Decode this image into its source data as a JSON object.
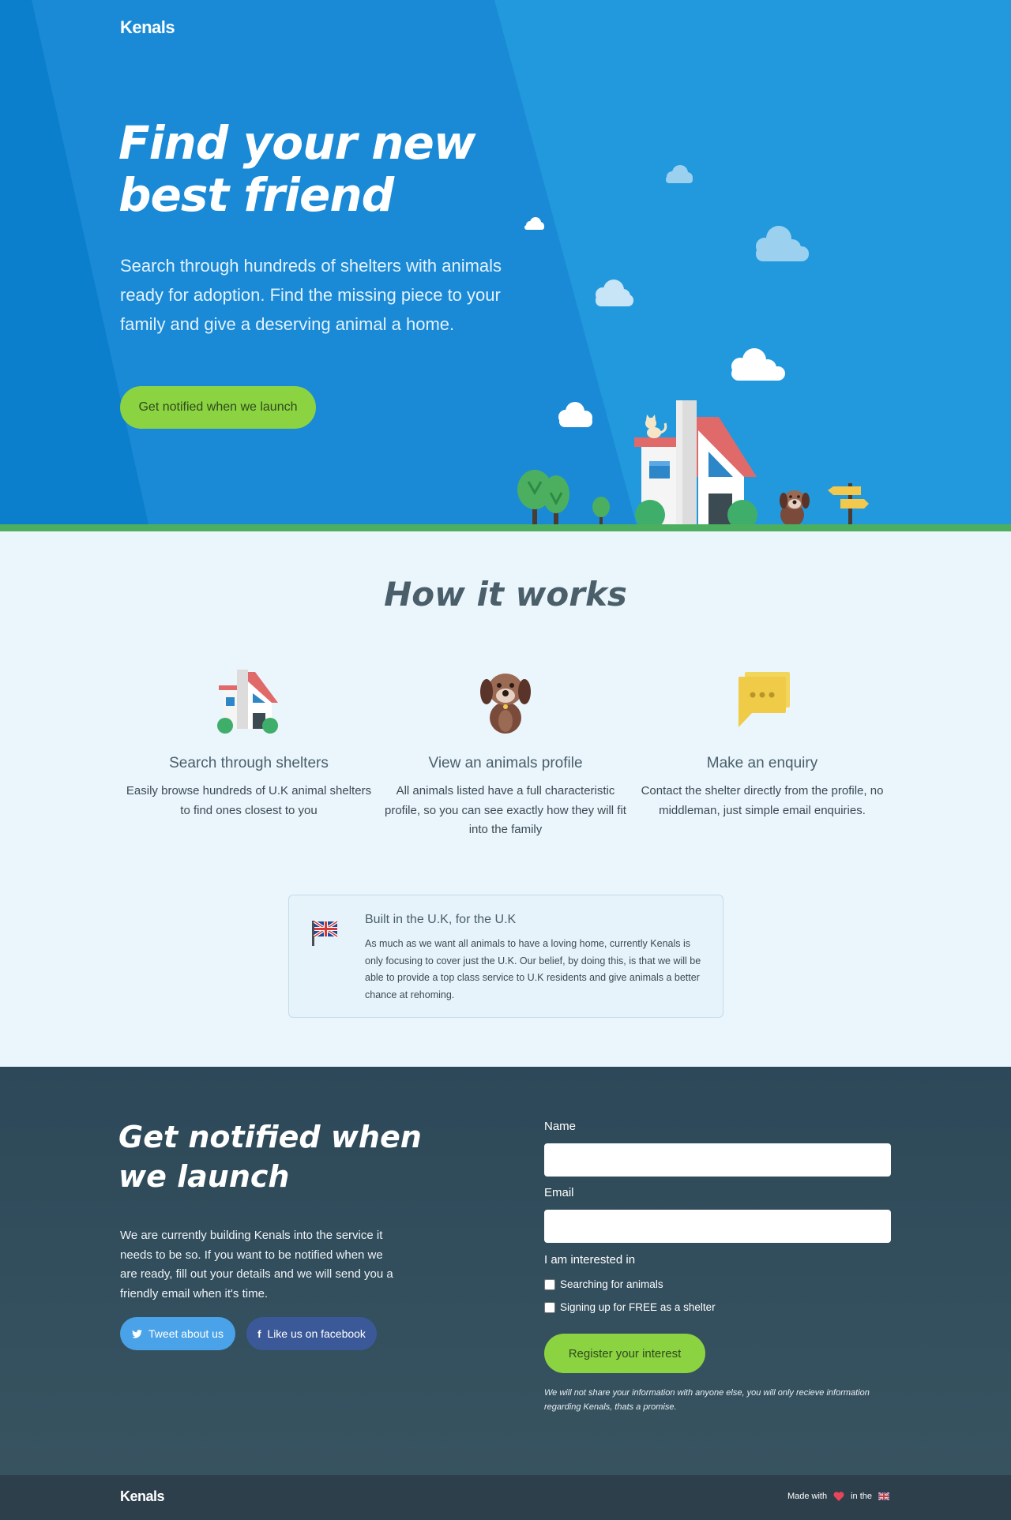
{
  "brand": "Kenals",
  "hero": {
    "title_line1": "Find your new",
    "title_line2": "best friend",
    "subtitle": "Search through hundreds of shelters with animals ready for adoption. Find the missing piece to your family and give a deserving animal a home.",
    "cta_label": "Get notified when we launch"
  },
  "how": {
    "title": "How it works",
    "features": [
      {
        "icon": "house-icon",
        "title": "Search through shelters",
        "text": "Easily browse hundreds of U.K animal shelters to find ones closest to you"
      },
      {
        "icon": "dog-icon",
        "title": "View an animals profile",
        "text": "All animals listed have a full characteristic profile, so you can see exactly how they will fit into the family"
      },
      {
        "icon": "chat-icon",
        "title": "Make an enquiry",
        "text": "Contact the shelter directly from the profile, no middleman, just simple email enquiries."
      }
    ],
    "uk_card": {
      "title": "Built in the U.K, for the U.K",
      "text": "As much as we want all animals to have a loving home, currently Kenals is only focusing to cover just the U.K. Our belief, by doing this, is that we will be able to provide a top class service to U.K residents and give animals a better chance at rehoming."
    }
  },
  "signup": {
    "title_line1": "Get notified when",
    "title_line2": "we launch",
    "text": "We are currently building Kenals into the service it needs to be so. If you want to be notified when we are ready, fill out your details and we will send you a friendly email when it's time.",
    "tweet_label": "Tweet about us",
    "facebook_label": "Like us on facebook",
    "form": {
      "name_label": "Name",
      "name_value": "",
      "email_label": "Email",
      "email_value": "",
      "interest_label": "I am interested in",
      "options": [
        "Searching for animals",
        "Signing up for FREE as a shelter"
      ],
      "submit_label": "Register your interest",
      "note": "We will not share your information with anyone else, you will only recieve information regarding Kenals, thats a promise."
    }
  },
  "footer": {
    "brand": "Kenals",
    "made_with": "Made with",
    "in_the": "in the"
  },
  "colors": {
    "hero_blue": "#2299dd",
    "accent_green": "#8bd341",
    "dark_slate": "#2d4959",
    "footer": "#2c3f4b",
    "twitter": "#4aa3e8",
    "facebook": "#3b5998",
    "heart": "#e8455a"
  }
}
